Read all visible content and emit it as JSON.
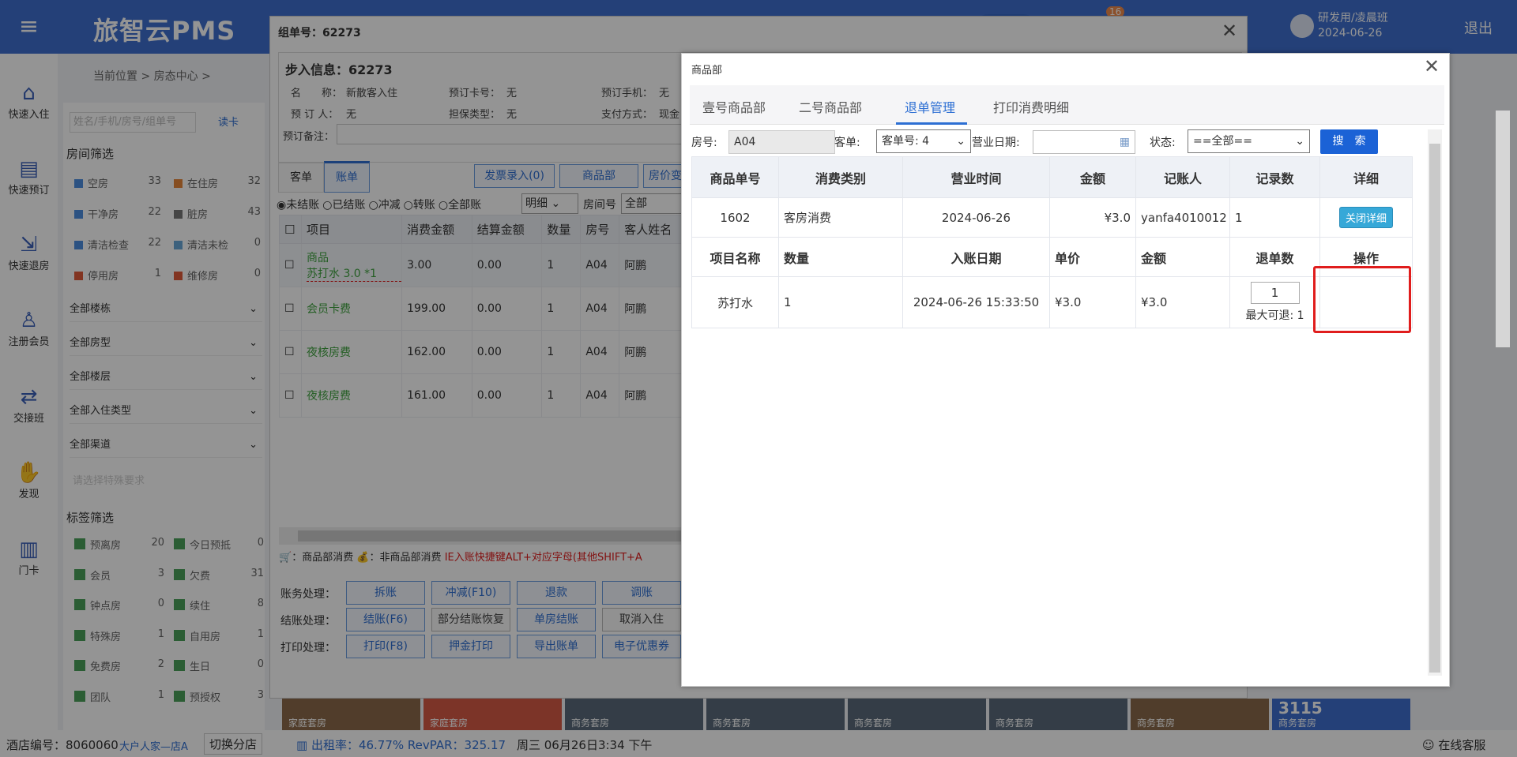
{
  "app": {
    "logo": "旅智云PMS",
    "menu_icon": "≡"
  },
  "header": {
    "user_line1": "研发用/凌晨班",
    "user_line2": "2024-06-26",
    "logout": "退出",
    "msg_count": "16"
  },
  "leftnav": {
    "items": [
      {
        "label": "快速入住",
        "icon": "⌂"
      },
      {
        "label": "快速预订",
        "icon": "▤"
      },
      {
        "label": "快速退房",
        "icon": "⇲"
      },
      {
        "label": "注册会员",
        "icon": "♙"
      },
      {
        "label": "交接班",
        "icon": "⇄"
      },
      {
        "label": "发现",
        "icon": "✋"
      },
      {
        "label": "门卡",
        "icon": "▥"
      }
    ]
  },
  "bg": {
    "breadcrumb": "当前位置 > 房态中心 >",
    "search_placeholder": "姓名/手机/房号/组单号",
    "read_card": "读卡",
    "room_filter_title": "房间筛选",
    "room_status": [
      {
        "label": "空房",
        "count": "33",
        "color": "#4d8ee0"
      },
      {
        "label": "在住房",
        "count": "32",
        "color": "#e7873a"
      },
      {
        "label": "干净房",
        "count": "22",
        "color": "#4d8ee0"
      },
      {
        "label": "脏房",
        "count": "43",
        "color": "#777777"
      },
      {
        "label": "清洁检查",
        "count": "22",
        "color": "#4d8ee0"
      },
      {
        "label": "清洁未检",
        "count": "0",
        "color": "#6aa7d8"
      },
      {
        "label": "停用房",
        "count": "1",
        "color": "#e05a3a"
      },
      {
        "label": "维修房",
        "count": "0",
        "color": "#e05a3a"
      }
    ],
    "selects": [
      "全部楼栋",
      "全部房型",
      "全部楼层",
      "全部入住类型",
      "全部渠道"
    ],
    "special_placeholder": "请选择特殊要求",
    "tag_filter_title": "标签筛选",
    "tags": [
      {
        "label": "预离房",
        "count": "20"
      },
      {
        "label": "今日预抵",
        "count": "0"
      },
      {
        "label": "会员",
        "count": "3"
      },
      {
        "label": "欠费",
        "count": "31"
      },
      {
        "label": "钟点房",
        "count": "0"
      },
      {
        "label": "续住",
        "count": "8"
      },
      {
        "label": "特殊房",
        "count": "1"
      },
      {
        "label": "自用房",
        "count": "1"
      },
      {
        "label": "免费房",
        "count": "2"
      },
      {
        "label": "生日",
        "count": "0"
      },
      {
        "label": "团队",
        "count": "1"
      },
      {
        "label": "预授权",
        "count": "3"
      }
    ],
    "tiles": [
      {
        "label": "家庭套房",
        "color": "#8c6a4a"
      },
      {
        "label": "家庭套房",
        "color": "#d65a45"
      },
      {
        "label": "商务套房",
        "color": "#5a6a7a"
      },
      {
        "label": "商务套房",
        "color": "#5a6a7a"
      },
      {
        "label": "商务套房",
        "color": "#5a6a7a"
      },
      {
        "label": "商务套房",
        "color": "#5a6a7a"
      },
      {
        "label": "商务套房",
        "color": "#8a6a4a"
      },
      {
        "label": "商务套房",
        "color": "#3e6fcf",
        "num": "3115"
      }
    ]
  },
  "footer": {
    "hotel_no": "酒店编号：8060060",
    "hotel_name": "大户人家—店A",
    "switch": "切换分店",
    "stats": "出租率：46.77% RevPAR：325.17",
    "datetime": "周三 06月26日3:34 下午",
    "service": "在线客服"
  },
  "dialog1": {
    "title": "组单号：62273",
    "section_title": "步入信息：62273",
    "info": {
      "name_label": "名　　称：",
      "name": "新散客入住",
      "booker_label": "预 订 人：",
      "booker": "无",
      "card_label": "预订卡号：",
      "card": "无",
      "guarantee_label": "担保类型：",
      "guarantee": "无",
      "phone_label": "预订手机：",
      "phone": "无",
      "pay_label": "支付方式：",
      "pay": "现金",
      "remark_label": "预订备注："
    },
    "tabs": [
      "客单",
      "账单"
    ],
    "buttons_top": [
      "发票录入(0)",
      "商品部",
      "房价变"
    ],
    "radios": [
      "未结账",
      "已结账",
      "冲减",
      "转账",
      "全部账"
    ],
    "detail_select": "明细",
    "room_label": "房间号",
    "room_select": "全部",
    "columns": [
      "项目",
      "消费金额",
      "结算金额",
      "数量",
      "房号",
      "客人姓名"
    ],
    "rows": [
      {
        "item": "商品",
        "item2": "苏打水 3.0 *1",
        "amount": "3.00",
        "settle": "0.00",
        "qty": "1",
        "room": "A04",
        "guest": "阿鹏"
      },
      {
        "item": "会员卡费",
        "amount": "199.00",
        "settle": "0.00",
        "qty": "1",
        "room": "A04",
        "guest": "阿鹏"
      },
      {
        "item": "夜核房费",
        "amount": "162.00",
        "settle": "0.00",
        "qty": "1",
        "room": "A04",
        "guest": "阿鹏"
      },
      {
        "item": "夜核房费",
        "amount": "161.00",
        "settle": "0.00",
        "qty": "1",
        "room": "A04",
        "guest": "阿鹏"
      }
    ],
    "legend": "：商品部消费",
    "legend2": "：非商品部消费",
    "hint": "IE入账快捷键ALT+对应字母(其他SHIFT+A",
    "row_labels": [
      "账务处理：",
      "结账处理：",
      "打印处理："
    ],
    "btns_r1": [
      "拆账",
      "冲减(F10)",
      "退款",
      "调账"
    ],
    "btns_r2": [
      "结账(F6)",
      "部分结账恢复",
      "单房结账",
      "取消入住"
    ],
    "btns_r3": [
      "打印(F8)",
      "押金打印",
      "导出账单",
      "电子优惠券"
    ]
  },
  "dialog2": {
    "title": "商品部",
    "tabs": [
      "壹号商品部",
      "二号商品部",
      "退单管理",
      "打印消费明细"
    ],
    "active_tab": 2,
    "room_label": "房号:",
    "room_value": "A04",
    "order_label": "客单:",
    "order_value": "客单号: 4",
    "date_label": "营业日期:",
    "status_label": "状态:",
    "status_value": "==全部==",
    "search_btn": "搜　索",
    "head": [
      "商品单号",
      "消费类别",
      "营业时间",
      "金额",
      "记账人",
      "记录数",
      "详细"
    ],
    "row1": {
      "no": "1602",
      "type": "客房消费",
      "time": "2024-06-26",
      "amount": "¥3.0",
      "clerk": "yanfa4010012",
      "count": "1",
      "btn": "关闭详细"
    },
    "head2": [
      "项目名称",
      "数量",
      "入账日期",
      "单价",
      "金额",
      "退单数",
      "操作"
    ],
    "row2": {
      "name": "苏打水",
      "qty": "1",
      "date": "2024-06-26 15:33:50",
      "price": "¥3.0",
      "amount": "¥3.0",
      "refund": "1",
      "max": "最大可退: 1"
    }
  }
}
